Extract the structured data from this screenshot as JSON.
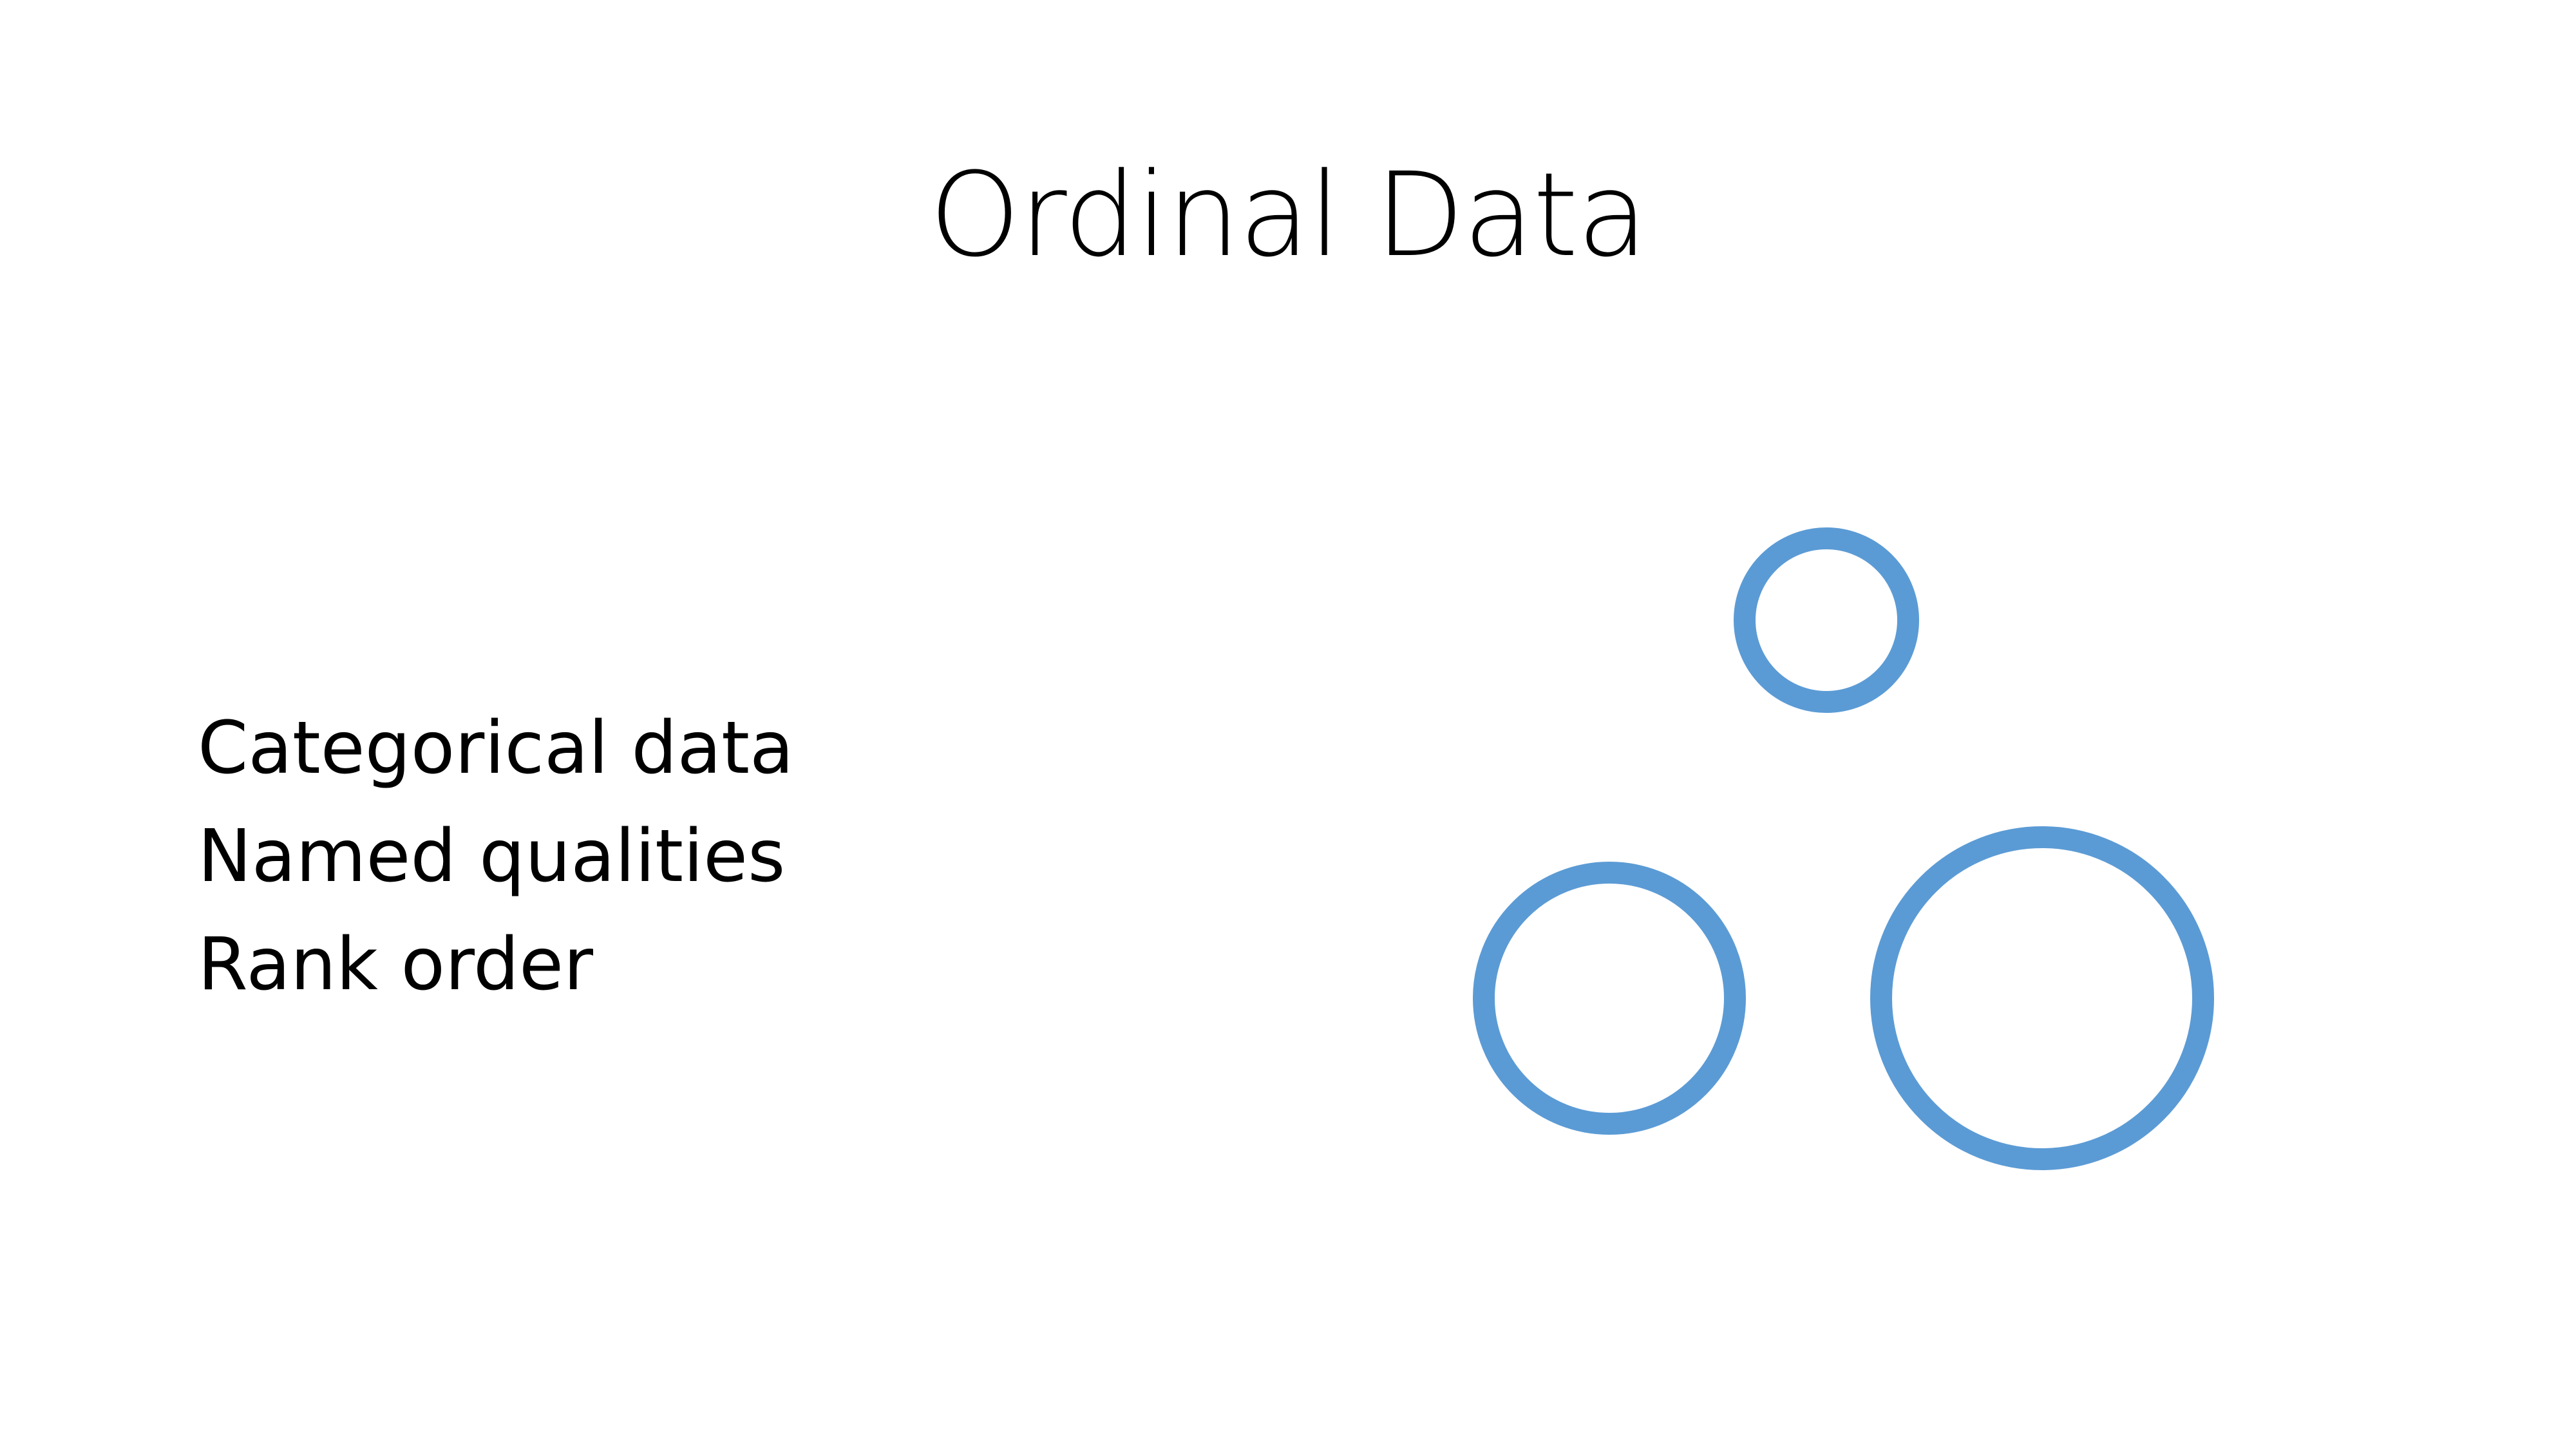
{
  "slide": {
    "title": "Ordinal Data",
    "bullets": [
      "Categorical data",
      "Named qualities",
      "Rank order"
    ],
    "shapes": {
      "color": "#5B9BD5",
      "items": [
        {
          "name": "small-circle"
        },
        {
          "name": "medium-circle"
        },
        {
          "name": "large-circle"
        }
      ]
    }
  }
}
